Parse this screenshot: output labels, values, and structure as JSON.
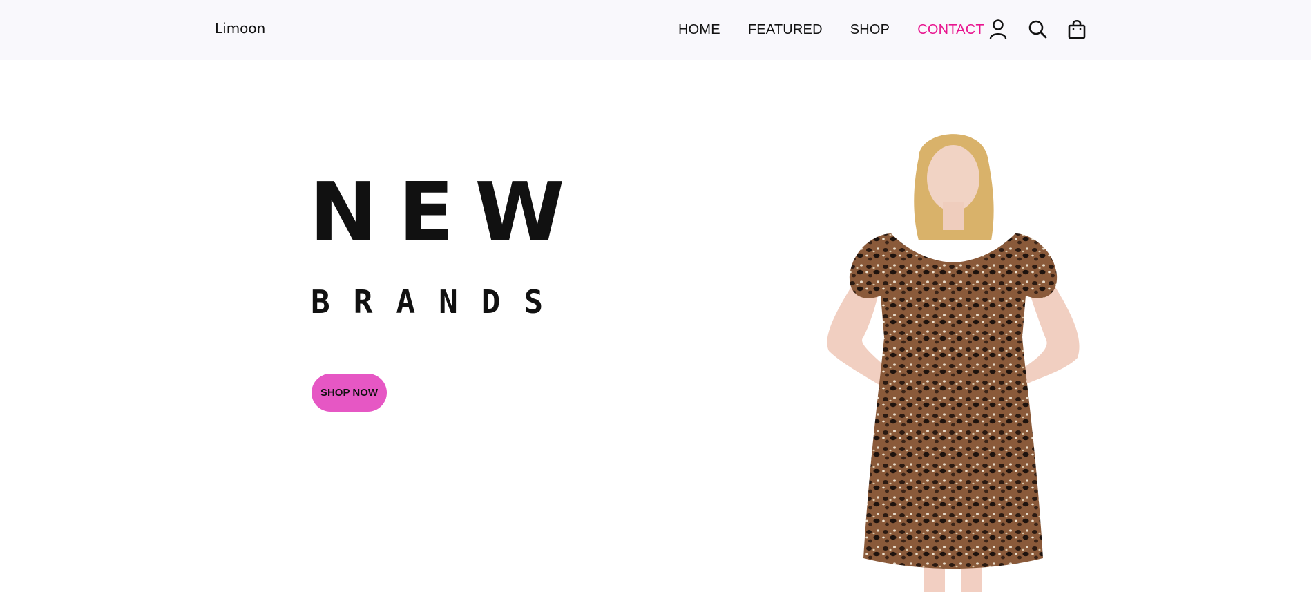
{
  "header": {
    "brand": "Limoon",
    "nav": [
      {
        "label": "HOME"
      },
      {
        "label": "FEATURED"
      },
      {
        "label": "SHOP"
      },
      {
        "label": "CONTACT"
      }
    ],
    "icons": [
      "user-icon",
      "search-icon",
      "bag-icon"
    ]
  },
  "hero": {
    "title": "NEW",
    "subtitle": "BRANDS",
    "cta_label": "SHOP NOW"
  },
  "colors": {
    "accent": "#e8158f",
    "button": "#e657c4",
    "header_bg": "#f9f8fc"
  }
}
